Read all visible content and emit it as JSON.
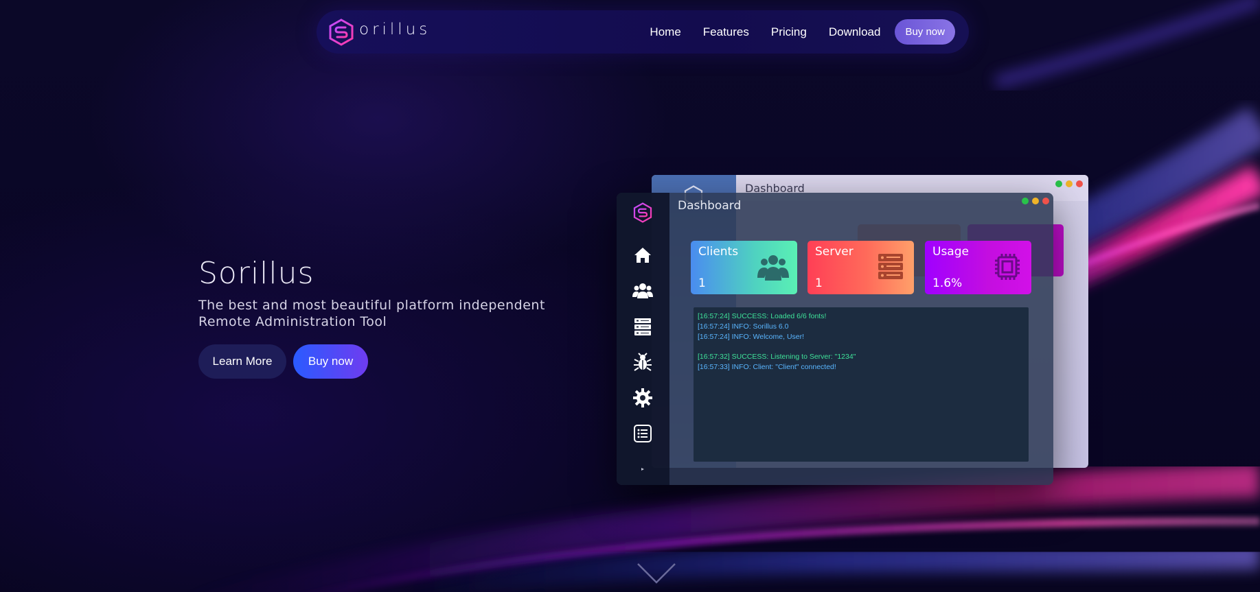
{
  "brand": {
    "name": "orillus"
  },
  "nav": {
    "links": [
      "Home",
      "Features",
      "Pricing",
      "Download"
    ],
    "buy_label": "Buy now"
  },
  "hero": {
    "title": "Sorillus",
    "subtitle_line1": "The best and most beautiful platform independent",
    "subtitle_line2": "Remote Administration Tool",
    "learn_more_label": "Learn More",
    "buy_label": "Buy now"
  },
  "app_back": {
    "title": "Dashboard"
  },
  "app": {
    "title": "Dashboard",
    "sidebar_icons": [
      "home-icon",
      "users-icon",
      "server-icon",
      "bug-icon",
      "gear-icon",
      "list-icon",
      "expand-icon"
    ],
    "cards": [
      {
        "label": "Clients",
        "value": "1",
        "icon": "users-icon"
      },
      {
        "label": "Server",
        "value": "1",
        "icon": "server-icon"
      },
      {
        "label": "Usage",
        "value": "1.6%",
        "icon": "cpu-icon"
      }
    ],
    "console": [
      {
        "text": "[16:57:24] SUCCESS: Loaded 6/6 fonts!",
        "level": "success"
      },
      {
        "text": "[16:57:24] INFO: Sorillus 6.0",
        "level": "info"
      },
      {
        "text": "[16:57:24] INFO: Welcome, User!",
        "level": "info"
      },
      {
        "text": "",
        "level": "info"
      },
      {
        "text": "[16:57:32] SUCCESS: Listening to Server: \"1234\"",
        "level": "success"
      },
      {
        "text": "[16:57:33] INFO: Client: \"Client\" connected!",
        "level": "info"
      }
    ]
  },
  "colors": {
    "background": "#080624",
    "nav_bg": "#140d52",
    "accent_buy": "#6f3cf0",
    "learn_btn": "#1e1d58",
    "card_clients": "#4fd2c0",
    "card_server": "#ff5a58",
    "card_usage": "#c40ee0",
    "log_success": "#3fe39a",
    "log_info": "#5ab6ff"
  }
}
